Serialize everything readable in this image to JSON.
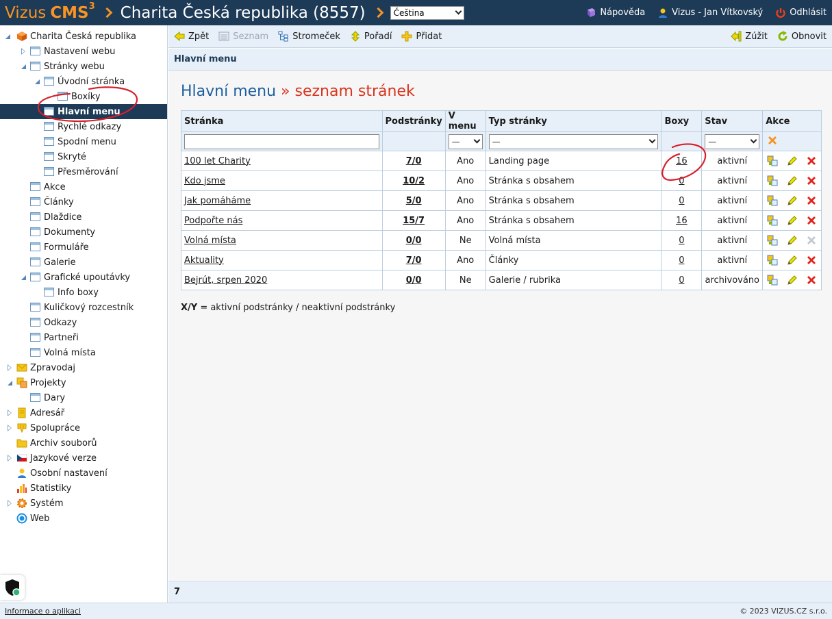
{
  "header": {
    "brand_name": "Vizus",
    "brand_product": "CMS",
    "brand_version": "3",
    "site_title": "Charita Česká republika (8557)",
    "language": "Čeština",
    "help_label": "Nápověda",
    "user_label": "Vizus - Jan Vítkovský",
    "logout_label": "Odhlásit"
  },
  "toolbar": {
    "back_label": "Zpět",
    "list_label": "Seznam",
    "tree_label": "Stromeček",
    "order_label": "Pořadí",
    "add_label": "Přidat",
    "narrow_label": "Zúžit",
    "refresh_label": "Obnovit"
  },
  "subbar": {
    "title": "Hlavní menu"
  },
  "page": {
    "title_main": "Hlavní menu",
    "title_sep": " » ",
    "title_sub": "seznam stránek"
  },
  "sidebar": {
    "items": [
      {
        "label": "Charita Česká republika"
      },
      {
        "label": "Nastavení webu"
      },
      {
        "label": "Stránky webu"
      },
      {
        "label": "Úvodní stránka"
      },
      {
        "label": "Boxíky"
      },
      {
        "label": "Hlavní menu"
      },
      {
        "label": "Rychlé odkazy"
      },
      {
        "label": "Spodní menu"
      },
      {
        "label": "Skryté"
      },
      {
        "label": "Přesměrování"
      },
      {
        "label": "Akce"
      },
      {
        "label": "Články"
      },
      {
        "label": "Dlaždice"
      },
      {
        "label": "Dokumenty"
      },
      {
        "label": "Formuláře"
      },
      {
        "label": "Galerie"
      },
      {
        "label": "Grafické upoutávky"
      },
      {
        "label": "Info boxy"
      },
      {
        "label": "Kuličkový rozcestník"
      },
      {
        "label": "Odkazy"
      },
      {
        "label": "Partneři"
      },
      {
        "label": "Volná místa"
      },
      {
        "label": "Zpravodaj"
      },
      {
        "label": "Projekty"
      },
      {
        "label": "Dary"
      },
      {
        "label": "Adresář"
      },
      {
        "label": "Spolupráce"
      },
      {
        "label": "Archiv souborů"
      },
      {
        "label": "Jazykové verze"
      },
      {
        "label": "Osobní nastavení"
      },
      {
        "label": "Statistiky"
      },
      {
        "label": "Systém"
      },
      {
        "label": "Web"
      }
    ]
  },
  "table": {
    "columns": [
      "Stránka",
      "Podstránky",
      "V menu",
      "Typ stránky",
      "Boxy",
      "Stav",
      "Akce"
    ],
    "filters": {
      "menu_value": "—",
      "type_value": "—",
      "state_value": "—"
    },
    "rows": [
      {
        "page": "100 let Charity",
        "sub": "7/0",
        "menu": "Ano",
        "type": "Landing page",
        "boxes": "16",
        "state": "aktivní"
      },
      {
        "page": "Kdo jsme",
        "sub": "10/2",
        "menu": "Ano",
        "type": "Stránka s obsahem",
        "boxes": "0",
        "state": "aktivní"
      },
      {
        "page": "Jak pomáháme",
        "sub": "5/0",
        "menu": "Ano",
        "type": "Stránka s obsahem",
        "boxes": "0",
        "state": "aktivní"
      },
      {
        "page": "Podpořte nás",
        "sub": "15/7",
        "menu": "Ano",
        "type": "Stránka s obsahem",
        "boxes": "16",
        "state": "aktivní"
      },
      {
        "page": "Volná místa",
        "sub": "0/0",
        "menu": "Ne",
        "type": "Volná místa",
        "boxes": "0",
        "state": "aktivní"
      },
      {
        "page": "Aktuality",
        "sub": "7/0",
        "menu": "Ano",
        "type": "Články",
        "boxes": "0",
        "state": "aktivní"
      },
      {
        "page": "Bejrút, srpen 2020",
        "sub": "0/0",
        "menu": "Ne",
        "type": "Galerie / rubrika",
        "boxes": "0",
        "state": "archivováno"
      }
    ]
  },
  "legend": {
    "key": "X/Y",
    "text": " = aktivní podstránky / neaktivní podstránky"
  },
  "count": "7",
  "footer": {
    "app_info": "Informace o aplikaci",
    "copyright": "© 2023 VIZUS.CZ s.r.o."
  },
  "colors": {
    "header_bg": "#1d3a56",
    "brand_orange": "#f79424",
    "title_blue": "#1f5f9f",
    "title_red": "#d9341f",
    "panel_bg": "#e7eff8",
    "annotation_red": "#d8202c"
  }
}
